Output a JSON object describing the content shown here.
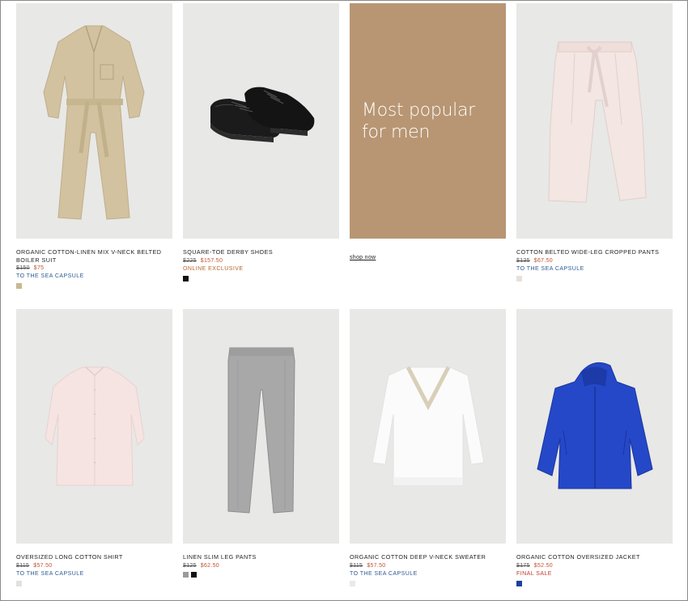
{
  "products": [
    {
      "name": "ORGANIC COTTON-LINEN MIX V-NECK BELTED BOILER SUIT",
      "old_price": "$150",
      "new_price": "$75",
      "tag": "TO THE SEA CAPSULE",
      "swatches": [
        "#c9b894"
      ],
      "illustration": "boiler-suit"
    },
    {
      "name": "SQUARE-TOE DERBY SHOES",
      "old_price": "$225",
      "new_price": "$157.50",
      "tag": "ONLINE EXCLUSIVE",
      "swatches": [
        "#111111"
      ],
      "illustration": "derby-shoes"
    },
    {
      "name": "COTTON BELTED WIDE-LEG CROPPED PANTS",
      "old_price": "$135",
      "new_price": "$67.50",
      "tag": "TO THE SEA CAPSULE",
      "swatches": [
        "#e6e0dc"
      ],
      "illustration": "wide-leg-pants"
    },
    {
      "name": "OVERSIZED LONG COTTON SHIRT",
      "old_price": "$115",
      "new_price": "$57.50",
      "tag": "TO THE SEA CAPSULE",
      "swatches": [
        "#e4e0de"
      ],
      "illustration": "long-shirt"
    },
    {
      "name": "LINEN SLIM LEG PANTS",
      "old_price": "$125",
      "new_price": "$62.50",
      "tag": "",
      "swatches": [
        "#9a9a9a",
        "#111111"
      ],
      "illustration": "slim-pants"
    },
    {
      "name": "ORGANIC COTTON DEEP V-NECK SWEATER",
      "old_price": "$115",
      "new_price": "$57.50",
      "tag": "TO THE SEA CAPSULE",
      "swatches": [
        "#e9e9e9"
      ],
      "illustration": "v-neck-sweater"
    },
    {
      "name": "ORGANIC COTTON OVERSIZED JACKET",
      "old_price": "$175",
      "new_price": "$52.50",
      "tag": "FINAL SALE",
      "swatches": [
        "#1f3f9c"
      ],
      "illustration": "oversized-jacket"
    }
  ],
  "promo": {
    "line1": "Most popular",
    "line2": "for men",
    "cta": "shop now",
    "bg": "#b89673"
  },
  "colors": {
    "sale": "#c0522f",
    "capsule_tag": "#2b5a95",
    "exclusive_tag": "#b5662c",
    "final_sale_tag": "#c0392b",
    "tile_bg": "#e8e8e6"
  }
}
